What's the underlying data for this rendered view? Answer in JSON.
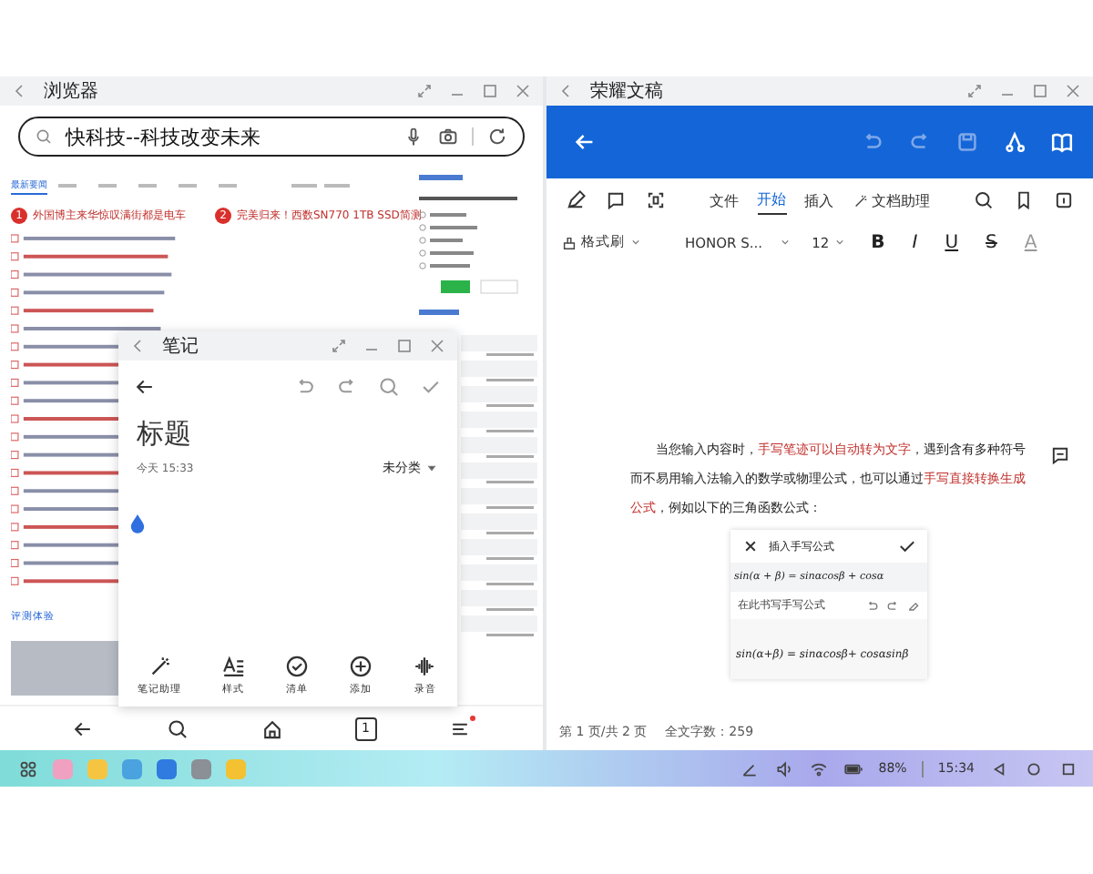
{
  "browser": {
    "title": "浏览器",
    "search_value": "快科技--科技改变未来",
    "tabs": [
      {
        "label": "最新要闻",
        "selected": true
      }
    ],
    "headlines": [
      {
        "number": "1",
        "text": "外国博主来华惊叹满街都是电车"
      },
      {
        "number": "2",
        "text": "完美归来！西数SN770 1TB SSD简测"
      }
    ],
    "section_label": "评测体验",
    "tab_count": "1",
    "menu_badge": true
  },
  "note": {
    "title": "笔记",
    "heading": "标题",
    "time": "今天 15:33",
    "category": "未分类",
    "tools": [
      {
        "kind": "assistant",
        "label": "笔记助理"
      },
      {
        "kind": "style",
        "label": "样式"
      },
      {
        "kind": "checklist",
        "label": "清单"
      },
      {
        "kind": "add",
        "label": "添加"
      },
      {
        "kind": "record",
        "label": "录音"
      }
    ]
  },
  "document": {
    "title": "荣耀文稿",
    "tabs": [
      {
        "label": "文件",
        "selected": false
      },
      {
        "label": "开始",
        "selected": true
      },
      {
        "label": "插入",
        "selected": false
      },
      {
        "label": "文档助理",
        "selected": false,
        "kind": "assistant"
      }
    ],
    "format_painter": "格式刷",
    "font": "HONOR S...",
    "font_size": "12",
    "format_buttons": [
      {
        "kind": "bold",
        "label": "B"
      },
      {
        "kind": "italic",
        "label": "I"
      },
      {
        "kind": "underline",
        "label": "U"
      },
      {
        "kind": "strike",
        "label": "S"
      },
      {
        "kind": "color",
        "label": "A"
      }
    ],
    "paragraph": [
      {
        "text": "当您输入内容时，",
        "highlight": false
      },
      {
        "text": "手写笔迹可以自动转为文字",
        "highlight": true
      },
      {
        "text": "，遇到含有多种符号而不易用输入法输入的数学或物理公式，也可以通过",
        "highlight": false
      },
      {
        "text": "手写直接转换生成公式",
        "highlight": true
      },
      {
        "text": "，例如以下的三角函数公式：",
        "highlight": false
      }
    ],
    "formula_panel": {
      "title": "插入手写公式",
      "result": "sin(α + β) = sinαcosβ + cosα",
      "hint": "在此书写手写公式",
      "handwriting": "sin(α+β) = sinαcosβ+ cosαsinβ"
    },
    "page_info": "第 1 页/共 2 页",
    "word_count": "全文字数：259"
  },
  "taskbar": {
    "battery": "88%",
    "time": "15:34"
  }
}
